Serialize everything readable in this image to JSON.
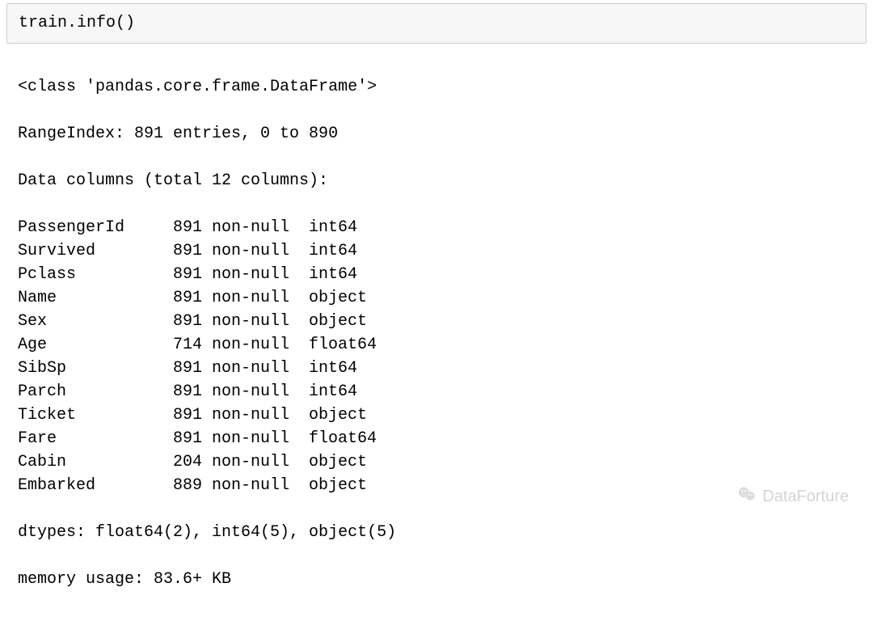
{
  "input": {
    "code": "train.info()"
  },
  "output": {
    "class_line": "<class 'pandas.core.frame.DataFrame'>",
    "rangeindex": "RangeIndex: 891 entries, 0 to 890",
    "columns_header": "Data columns (total 12 columns):",
    "columns": [
      {
        "name": "PassengerId",
        "count": "891",
        "nn": "non-null",
        "dtype": "int64"
      },
      {
        "name": "Survived",
        "count": "891",
        "nn": "non-null",
        "dtype": "int64"
      },
      {
        "name": "Pclass",
        "count": "891",
        "nn": "non-null",
        "dtype": "int64"
      },
      {
        "name": "Name",
        "count": "891",
        "nn": "non-null",
        "dtype": "object"
      },
      {
        "name": "Sex",
        "count": "891",
        "nn": "non-null",
        "dtype": "object"
      },
      {
        "name": "Age",
        "count": "714",
        "nn": "non-null",
        "dtype": "float64"
      },
      {
        "name": "SibSp",
        "count": "891",
        "nn": "non-null",
        "dtype": "int64"
      },
      {
        "name": "Parch",
        "count": "891",
        "nn": "non-null",
        "dtype": "int64"
      },
      {
        "name": "Ticket",
        "count": "891",
        "nn": "non-null",
        "dtype": "object"
      },
      {
        "name": "Fare",
        "count": "891",
        "nn": "non-null",
        "dtype": "float64"
      },
      {
        "name": "Cabin",
        "count": "204",
        "nn": "non-null",
        "dtype": "object"
      },
      {
        "name": "Embarked",
        "count": "889",
        "nn": "non-null",
        "dtype": "object"
      }
    ],
    "dtypes_line": "dtypes: float64(2), int64(5), object(5)",
    "memory_line": "memory usage: 83.6+ KB"
  },
  "watermark": {
    "text": "DataForture"
  }
}
